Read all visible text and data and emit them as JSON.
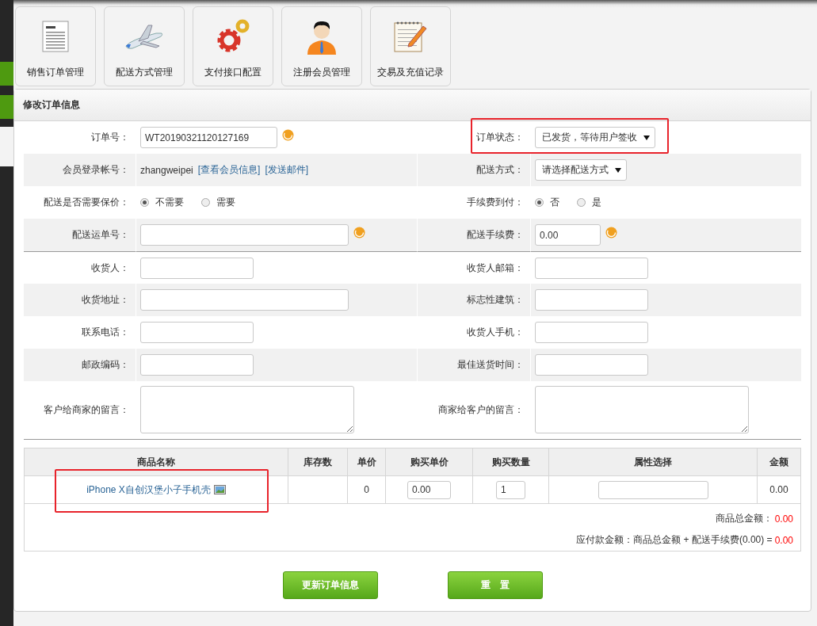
{
  "tiles": [
    {
      "label": "销售订单管理",
      "kind": "document"
    },
    {
      "label": "配送方式管理",
      "kind": "airplane"
    },
    {
      "label": "支付接口配置",
      "kind": "gears"
    },
    {
      "label": "注册会员管理",
      "kind": "person"
    },
    {
      "label": "交易及充值记录",
      "kind": "notepad"
    }
  ],
  "sidebar_tabs": [
    {
      "selected": false
    },
    {
      "selected": false
    },
    {
      "selected": true
    }
  ],
  "panel": {
    "title": "修改订单信息"
  },
  "form_rows": [
    {
      "cells": [
        {
          "label": "订单号：",
          "kind": "text",
          "value": "WT20190321120127169",
          "help": true
        },
        {
          "label": "订单状态：",
          "kind": "select",
          "value": "已发货，等待用户签收",
          "highlighted": true
        }
      ]
    },
    {
      "cells": [
        {
          "label": "会员登录帐号：",
          "kind": "account",
          "value": "zhangweipei",
          "links": [
            "[查看会员信息]",
            "[发送邮件]"
          ]
        },
        {
          "label": "配送方式：",
          "kind": "select",
          "value": "请选择配送方式"
        }
      ]
    },
    {
      "cells": [
        {
          "label": "配送是否需要保价：",
          "kind": "radio",
          "options": [
            {
              "label": "不需要",
              "selected": true
            },
            {
              "label": "需要",
              "selected": false
            }
          ]
        },
        {
          "label": "手续费到付：",
          "kind": "radio",
          "options": [
            {
              "label": "否",
              "selected": true
            },
            {
              "label": "是",
              "selected": false
            }
          ]
        }
      ]
    },
    {
      "cells": [
        {
          "label": "配送运单号：",
          "kind": "text",
          "wide": true,
          "help": true
        },
        {
          "label": "配送手续费：",
          "kind": "text",
          "value": "0.00",
          "narrow": true,
          "help": true
        }
      ]
    },
    {
      "cells": [
        {
          "label": "收货人：",
          "kind": "text"
        },
        {
          "label": "收货人邮箱：",
          "kind": "text"
        }
      ]
    },
    {
      "cells": [
        {
          "label": "收货地址：",
          "kind": "text",
          "wide": true
        },
        {
          "label": "标志性建筑：",
          "kind": "text"
        }
      ]
    },
    {
      "cells": [
        {
          "label": "联系电话：",
          "kind": "text"
        },
        {
          "label": "收货人手机：",
          "kind": "text"
        }
      ]
    },
    {
      "cells": [
        {
          "label": "邮政编码：",
          "kind": "text"
        },
        {
          "label": "最佳送货时间：",
          "kind": "text"
        }
      ]
    },
    {
      "cells": [
        {
          "label": "客户给商家的留言：",
          "kind": "textarea"
        },
        {
          "label": "商家给客户的留言：",
          "kind": "textarea"
        }
      ]
    }
  ],
  "products": {
    "columns": [
      "商品名称",
      "库存数",
      "单价",
      "购买单价",
      "购买数量",
      "属性选择",
      "金额"
    ],
    "rows": [
      {
        "name": "iPhone X自创汉堡小子手机壳",
        "highlighted": true,
        "unit_price": "0",
        "purchase_price": "0.00",
        "quantity": "1",
        "amount": "0.00"
      }
    ],
    "totals": [
      {
        "label": "商品总金额：",
        "value": "0.00"
      },
      {
        "label": "应付款金额：商品总金额 + 配送手续费(0.00) =",
        "value": "0.00"
      }
    ]
  },
  "buttons": [
    "更新订单信息",
    "重　置"
  ]
}
